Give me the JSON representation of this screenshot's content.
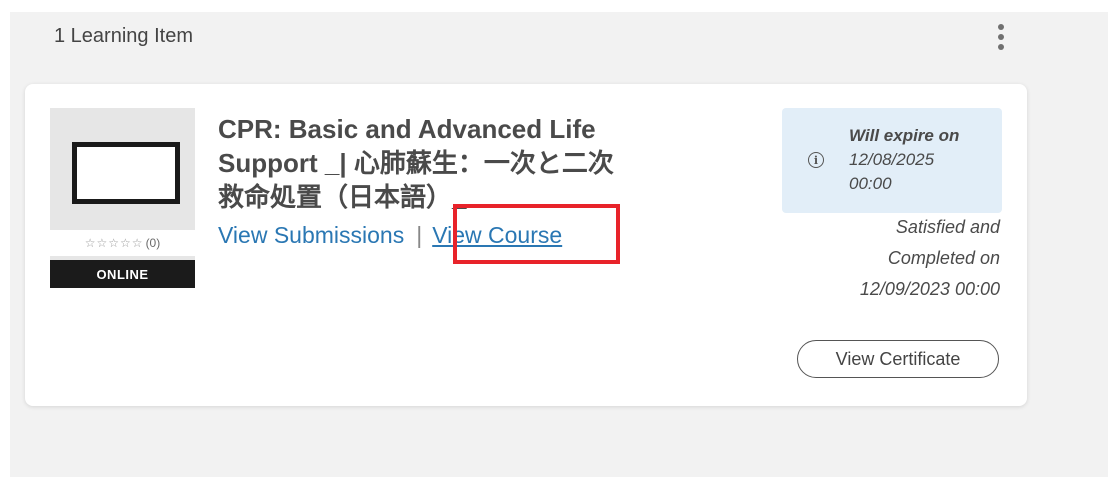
{
  "header": {
    "title": "1 Learning Item"
  },
  "card": {
    "thumbnail": {
      "rating_stars": "☆☆☆☆☆",
      "rating_count": "(0)",
      "badge": "ONLINE"
    },
    "title_line1": "CPR: Basic and Advanced Life",
    "title_line2": "Support _| 心肺蘇生：一次と二次",
    "title_line3": "救命処置（日本語）_",
    "links": {
      "submissions": "View Submissions",
      "separator": "|",
      "course": "View Course"
    },
    "expire": {
      "label": "Will expire on",
      "date": "12/08/2025",
      "time": "00:00"
    },
    "completion": {
      "line1": "Satisfied and",
      "line2": "Completed on",
      "line3": "12/09/2023 00:00"
    },
    "certificate_button": "View Certificate"
  },
  "colors": {
    "link": "#2a77b3",
    "highlight": "#e8232a",
    "expire_bg": "#e2eef8",
    "badge_bg": "#1b1b1b"
  },
  "icons": {
    "menu": "more-vertical-icon",
    "info": "info-icon",
    "star": "star-outline-icon"
  }
}
